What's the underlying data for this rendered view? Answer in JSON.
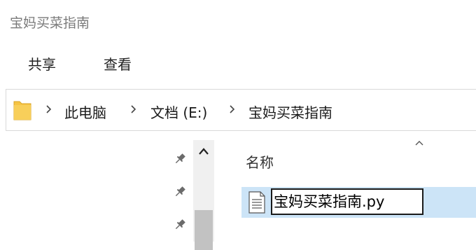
{
  "window": {
    "title": "宝妈买菜指南"
  },
  "ribbon": {
    "tabs": [
      {
        "label": "共享"
      },
      {
        "label": "查看"
      }
    ]
  },
  "address": {
    "folder_icon": "folder-icon",
    "crumbs": [
      {
        "label": "此电脑"
      },
      {
        "label": "文档 (E:)"
      },
      {
        "label": "宝妈买菜指南"
      }
    ],
    "separator_icon": "chevron-right-icon"
  },
  "nav": {
    "pin_icon": "pin-icon",
    "pins": 3,
    "scroll_up_icon": "chevron-up-icon"
  },
  "file_list": {
    "sort_icon": "chevron-up-icon",
    "columns": [
      {
        "label": "名称"
      }
    ],
    "items": [
      {
        "name": "宝妈买菜指南.py",
        "icon": "text-file-icon",
        "selected": true,
        "renaming": true
      }
    ]
  },
  "colors": {
    "selection": "#cce4f7",
    "border": "#d9d9d9",
    "scrollbar": "#f0f0f0",
    "scroll_thumb": "#c2c2c2",
    "folder": "#f6c444"
  }
}
